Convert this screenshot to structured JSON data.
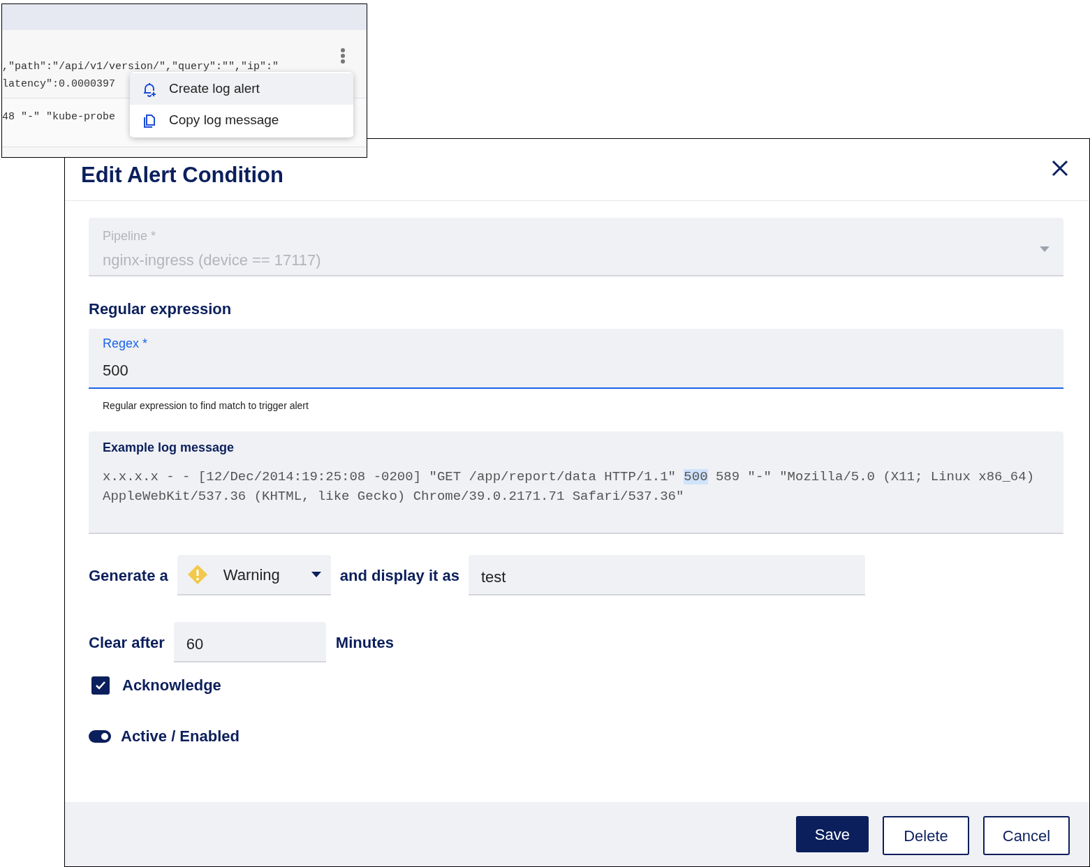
{
  "log_view": {
    "lines": [
      ",\"path\":\"/api/v1/version/\",\"query\":\"\",\"ip\":\"",
      "latency\":0.0000397",
      "48 \"-\" \"kube-probe"
    ],
    "menu": [
      {
        "kind": "alert",
        "label": "Create log alert",
        "selected": true
      },
      {
        "kind": "copy",
        "label": "Copy log message",
        "selected": false
      }
    ]
  },
  "dialog": {
    "title": "Edit Alert Condition",
    "pipeline": {
      "label": "Pipeline *",
      "value": "nginx-ingress (device == 17117)",
      "disabled": true
    },
    "regex_section": "Regular expression",
    "regex": {
      "label": "Regex *",
      "value": "500",
      "focused": true,
      "helper": "Regular expression to find match to trigger alert"
    },
    "example": {
      "label": "Example log message",
      "parts": [
        {
          "text": "x.x.x.x - - [12/Dec/2014:19:25:08 -0200] \"GET /app/report/data HTTP/1.1\" ",
          "highlighted": false
        },
        {
          "text": "500",
          "highlighted": true
        },
        {
          "text": " 589 \"-\" \"Mozilla/5.0 (X11; Linux x86_64) AppleWebKit/537.36 (KHTML, like Gecko) Chrome/39.0.2171.71 Safari/537.36\"",
          "highlighted": false
        }
      ]
    },
    "generate_label": "Generate a",
    "severity": "Warning",
    "display_label": "and display it as",
    "display_value": "test",
    "clear_label": "Clear after",
    "clear_value": "60",
    "clear_unit": "Minutes",
    "acknowledge": {
      "label": "Acknowledge",
      "checked": true
    },
    "active": {
      "label": "Active / Enabled",
      "on": true
    },
    "buttons": [
      {
        "kind": "primary",
        "label": "Save"
      },
      {
        "kind": "outline",
        "label": "Delete"
      },
      {
        "kind": "outline",
        "label": "Cancel"
      }
    ]
  }
}
